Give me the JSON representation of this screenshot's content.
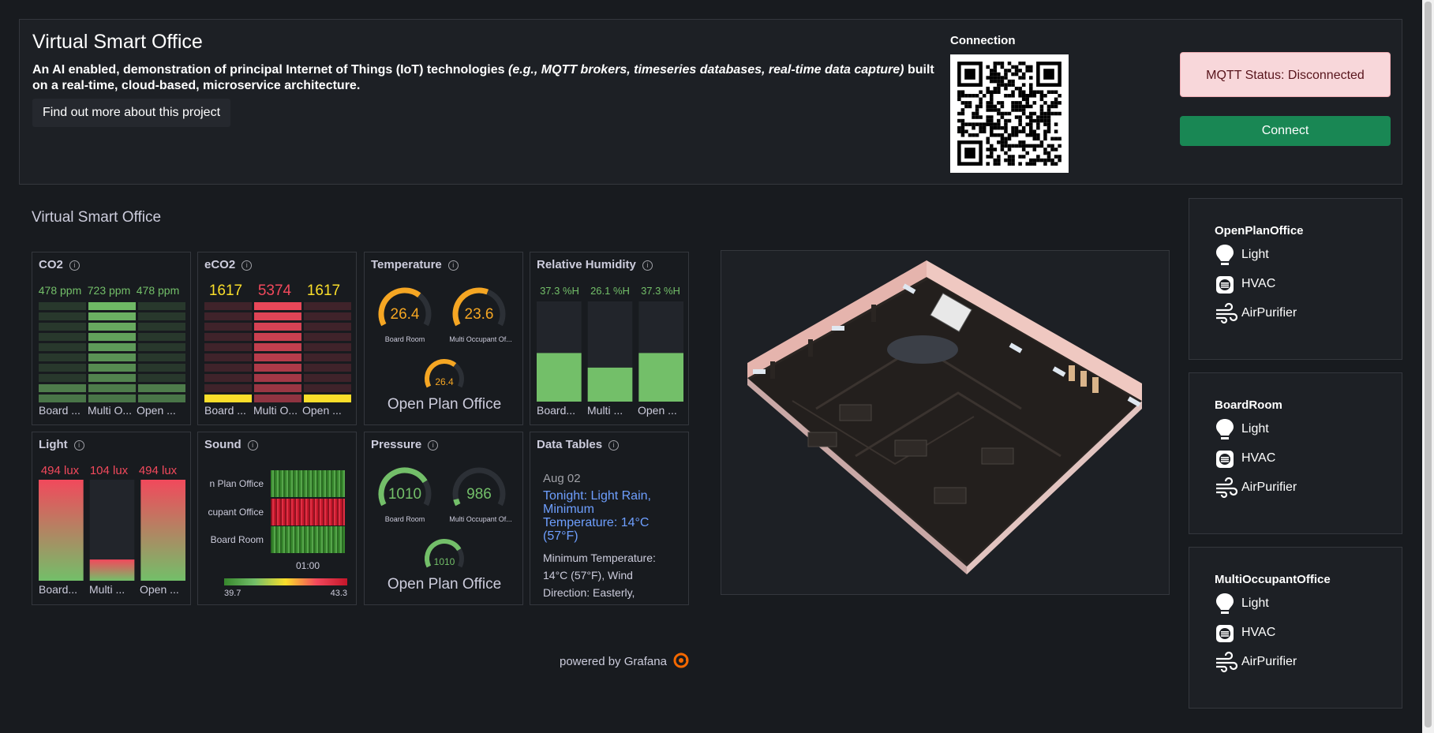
{
  "header": {
    "title": "Virtual Smart Office",
    "desc_pre": "An AI enabled, demonstration of principal Internet of Things (IoT) technologies ",
    "desc_em": "(e.g., MQTT brokers, timeseries databases, real-time data capture)",
    "desc_post": " built on a real-time, cloud-based, microservice architecture.",
    "more_button": "Find out more about this project",
    "connection_label": "Connection",
    "mqtt_status": "MQTT Status: Disconnected",
    "connect_button": "Connect"
  },
  "dashboard": {
    "title": "Virtual Smart Office",
    "info_icon": "info-icon",
    "co2": {
      "title": "CO2",
      "values": [
        "478 ppm",
        "723 ppm",
        "478 ppm"
      ],
      "labels": [
        "Board ...",
        "Multi O...",
        "Open ..."
      ],
      "levels": [
        0.2,
        1.0,
        0.2
      ],
      "color": "#73bf69"
    },
    "eco2": {
      "title": "eCO2",
      "values": [
        "1617",
        "5374",
        "1617"
      ],
      "labels": [
        "Board ...",
        "Multi O...",
        "Open ..."
      ],
      "levels": [
        0.1,
        1.0,
        0.1
      ],
      "colors": [
        "#fade2a",
        "#f2495c",
        "#fade2a"
      ]
    },
    "temperature": {
      "title": "Temperature",
      "gauges": [
        {
          "value": "26.4",
          "label": "Board Room",
          "level": 0.66
        },
        {
          "value": "23.6",
          "label": "Multi Occupant Of...",
          "level": 0.59
        },
        {
          "value": "26.4",
          "label": "",
          "level": 0.66
        }
      ],
      "big_label": "Open Plan Office",
      "color": "#f5a623"
    },
    "humidity": {
      "title": "Relative Humidity",
      "values": [
        "37.3 %H",
        "26.1 %H",
        "37.3 %H"
      ],
      "labels": [
        "Board...",
        "Multi ...",
        "Open ..."
      ],
      "levels": [
        0.373,
        0.261,
        0.373
      ],
      "color": "#73bf69"
    },
    "light": {
      "title": "Light",
      "values": [
        "494 lux",
        "104 lux",
        "494 lux"
      ],
      "labels": [
        "Board...",
        "Multi ...",
        "Open ..."
      ],
      "levels": [
        1.0,
        0.21,
        1.0
      ],
      "color_top": "#f2495c",
      "color_bottom": "#73bf69"
    },
    "sound": {
      "title": "Sound",
      "rows": [
        "n Plan Office",
        "cupant Office",
        "Board Room"
      ],
      "time_label": "01:00",
      "scale_min": "39.7",
      "scale_max": "43.3"
    },
    "pressure": {
      "title": "Pressure",
      "gauges": [
        {
          "value": "1010",
          "label": "Board Room",
          "level": 0.75
        },
        {
          "value": "986",
          "label": "Multi Occupant Of...",
          "level": 0.06
        },
        {
          "value": "1010",
          "label": "",
          "level": 0.75
        }
      ],
      "big_label": "Open Plan Office",
      "color": "#73bf69"
    },
    "data_tables": {
      "title": "Data Tables",
      "date": "Aug 02",
      "headline": "Tonight: Light Rain, Minimum Temperature: 14°C (57°F)",
      "body": "Minimum Temperature: 14°C (57°F), Wind Direction: Easterly,"
    },
    "powered_by": "powered by Grafana"
  },
  "rooms": [
    {
      "name": "OpenPlanOffice",
      "devices": [
        "Light",
        "HVAC",
        "AirPurifier"
      ]
    },
    {
      "name": "BoardRoom",
      "devices": [
        "Light",
        "HVAC",
        "AirPurifier"
      ]
    },
    {
      "name": "MultiOccupantOffice",
      "devices": [
        "Light",
        "HVAC",
        "AirPurifier"
      ]
    }
  ],
  "icons": {
    "light": "lightbulb-icon",
    "hvac": "hvac-icon",
    "air": "wind-icon",
    "grafana": "grafana-logo-icon",
    "qr": "qr-code-icon"
  }
}
